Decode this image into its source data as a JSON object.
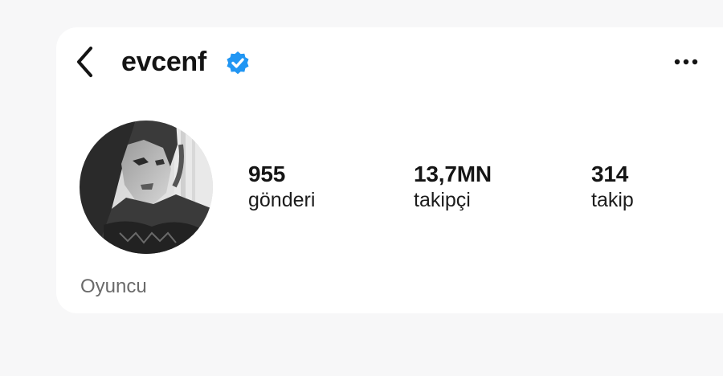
{
  "profile": {
    "username": "evcenf",
    "verified": true,
    "bio": "Oyuncu"
  },
  "stats": [
    {
      "value": "955",
      "label": "gönderi"
    },
    {
      "value": "13,7MN",
      "label": "takipçi"
    },
    {
      "value": "314",
      "label": "takip"
    }
  ],
  "icons": {
    "back": "chevron-left-icon",
    "verified": "verified-badge-icon",
    "more": "more-options-icon"
  },
  "colors": {
    "verified": "#2196f3",
    "text": "#141414",
    "bio": "#6a6a6a",
    "background": "#f7f7f8",
    "card": "#ffffff"
  }
}
